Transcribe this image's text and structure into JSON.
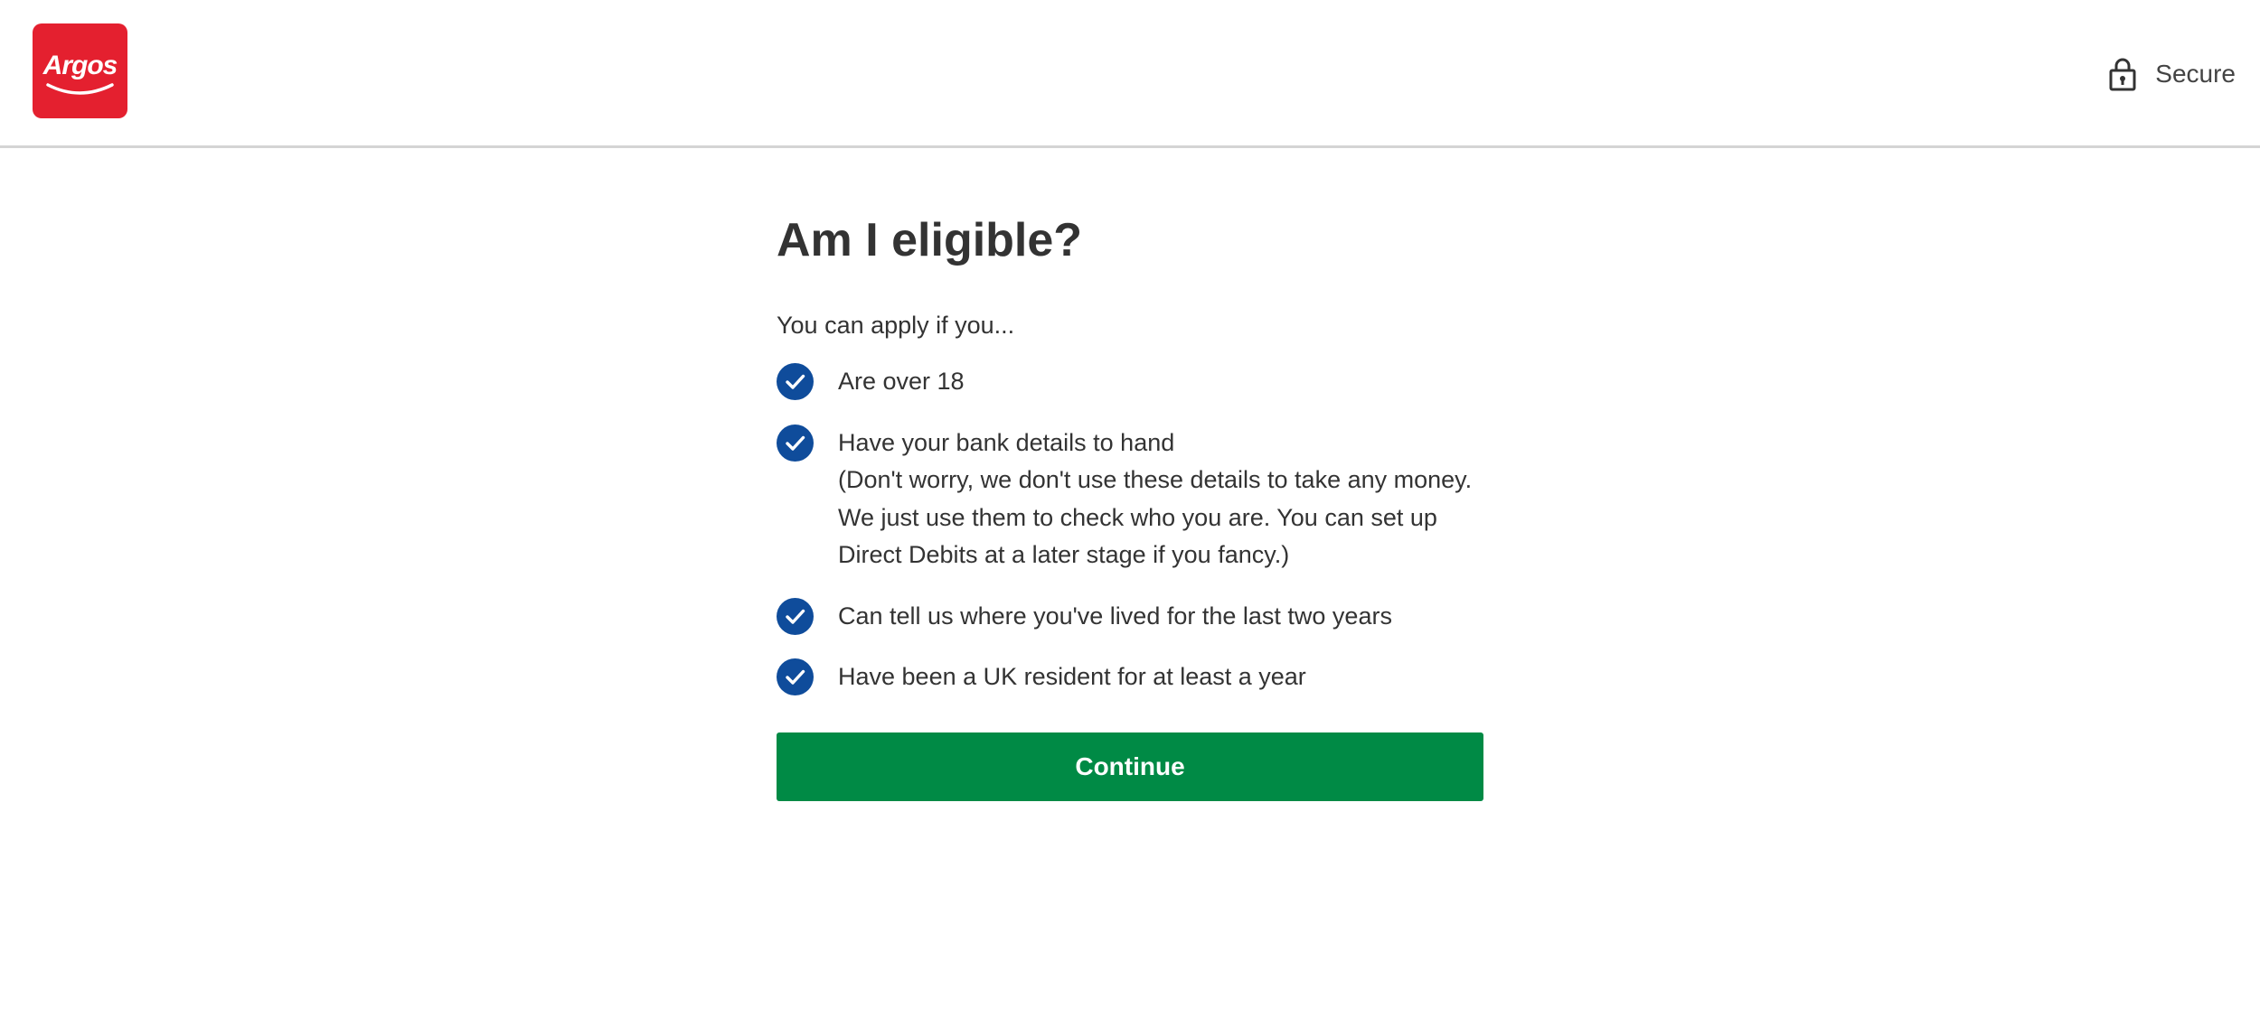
{
  "header": {
    "logo_text": "Argos",
    "secure_label": "Secure"
  },
  "main": {
    "title": "Am I eligible?",
    "intro": "You can apply if you...",
    "items": [
      {
        "label": "Are over 18"
      },
      {
        "label": "Have your bank details to hand",
        "detail": "(Don't worry, we don't use these details to take any money. We just use them to check who you are. You can set up Direct Debits at a later stage if you fancy.)"
      },
      {
        "label": "Can tell us where you've lived for the last two years"
      },
      {
        "label": "Have been a UK resident for at least a year"
      }
    ],
    "continue_label": "Continue"
  },
  "colors": {
    "brand_red": "#e4202f",
    "check_blue": "#0f4c9b",
    "continue_green": "#008a45"
  },
  "icons": {
    "lock": "lock-icon",
    "check": "check-circle-icon"
  }
}
